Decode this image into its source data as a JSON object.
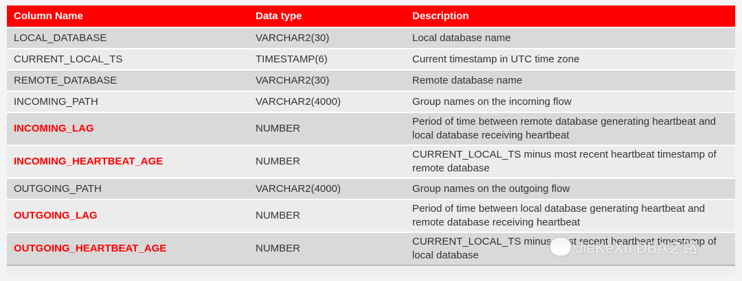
{
  "columns": [
    "Column Name",
    "Data type",
    "Description"
  ],
  "rows": [
    {
      "name": "LOCAL_DATABASE",
      "type": "VARCHAR2(30)",
      "desc": "Local database name",
      "highlight": false
    },
    {
      "name": "CURRENT_LOCAL_TS",
      "type": "TIMESTAMP(6)",
      "desc": "Current timestamp in UTC time zone",
      "highlight": false
    },
    {
      "name": "REMOTE_DATABASE",
      "type": "VARCHAR2(30)",
      "desc": "Remote database name",
      "highlight": false
    },
    {
      "name": "INCOMING_PATH",
      "type": "VARCHAR2(4000)",
      "desc": "Group names on the incoming flow",
      "highlight": false
    },
    {
      "name": "INCOMING_LAG",
      "type": "NUMBER",
      "desc": "Period of time between remote database generating heartbeat and local database receiving heartbeat",
      "highlight": true
    },
    {
      "name": "INCOMING_HEARTBEAT_AGE",
      "type": "NUMBER",
      "desc": "CURRENT_LOCAL_TS minus most recent heartbeat timestamp of remote database",
      "highlight": true
    },
    {
      "name": "OUTGOING_PATH",
      "type": "VARCHAR2(4000)",
      "desc": "Group names on the outgoing flow",
      "highlight": false
    },
    {
      "name": "OUTGOING_LAG",
      "type": "NUMBER",
      "desc": "Period of time between local database generating heartbeat and remote database receiving heartbeat",
      "highlight": true
    },
    {
      "name": "OUTGOING_HEARTBEAT_AGE",
      "type": "NUMBER",
      "desc": "CURRENT_LOCAL_TS minus most recent heartbeat timestamp of local database",
      "highlight": true
    }
  ],
  "watermark": "JieKeXu DBA之路",
  "colors": {
    "header": "#ff0000",
    "highlight": "#ff0000"
  }
}
